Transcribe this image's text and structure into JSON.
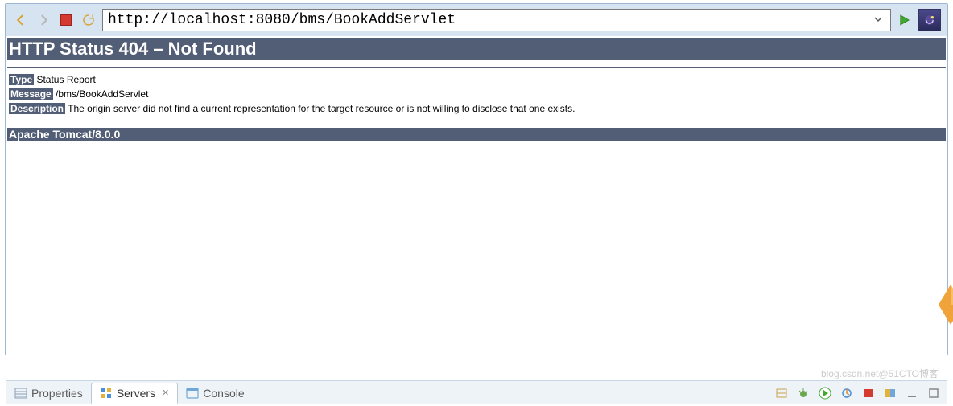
{
  "toolbar": {
    "url": "http://localhost:8080/bms/BookAddServlet",
    "icons": {
      "back": "back-arrow-icon",
      "forward": "forward-arrow-icon",
      "stop": "stop-icon",
      "refresh": "refresh-icon",
      "dropdown": "chevron-down-icon",
      "go": "go-icon",
      "eclipse": "eclipse-icon"
    }
  },
  "page": {
    "heading": "HTTP Status 404 – Not Found",
    "lines": [
      {
        "label": "Type",
        "text": " Status Report"
      },
      {
        "label": "Message",
        "text": " /bms/BookAddServlet"
      },
      {
        "label": "Description",
        "text": " The origin server did not find a current representation for the target resource or is not willing to disclose that one exists."
      }
    ],
    "footer": "Apache Tomcat/8.0.0"
  },
  "bottom_tabs": {
    "items": [
      {
        "label": "Properties",
        "active": false
      },
      {
        "label": "Servers",
        "active": true
      },
      {
        "label": "Console",
        "active": false
      }
    ]
  },
  "watermark": "blog.csdn.net@51CTO博客"
}
